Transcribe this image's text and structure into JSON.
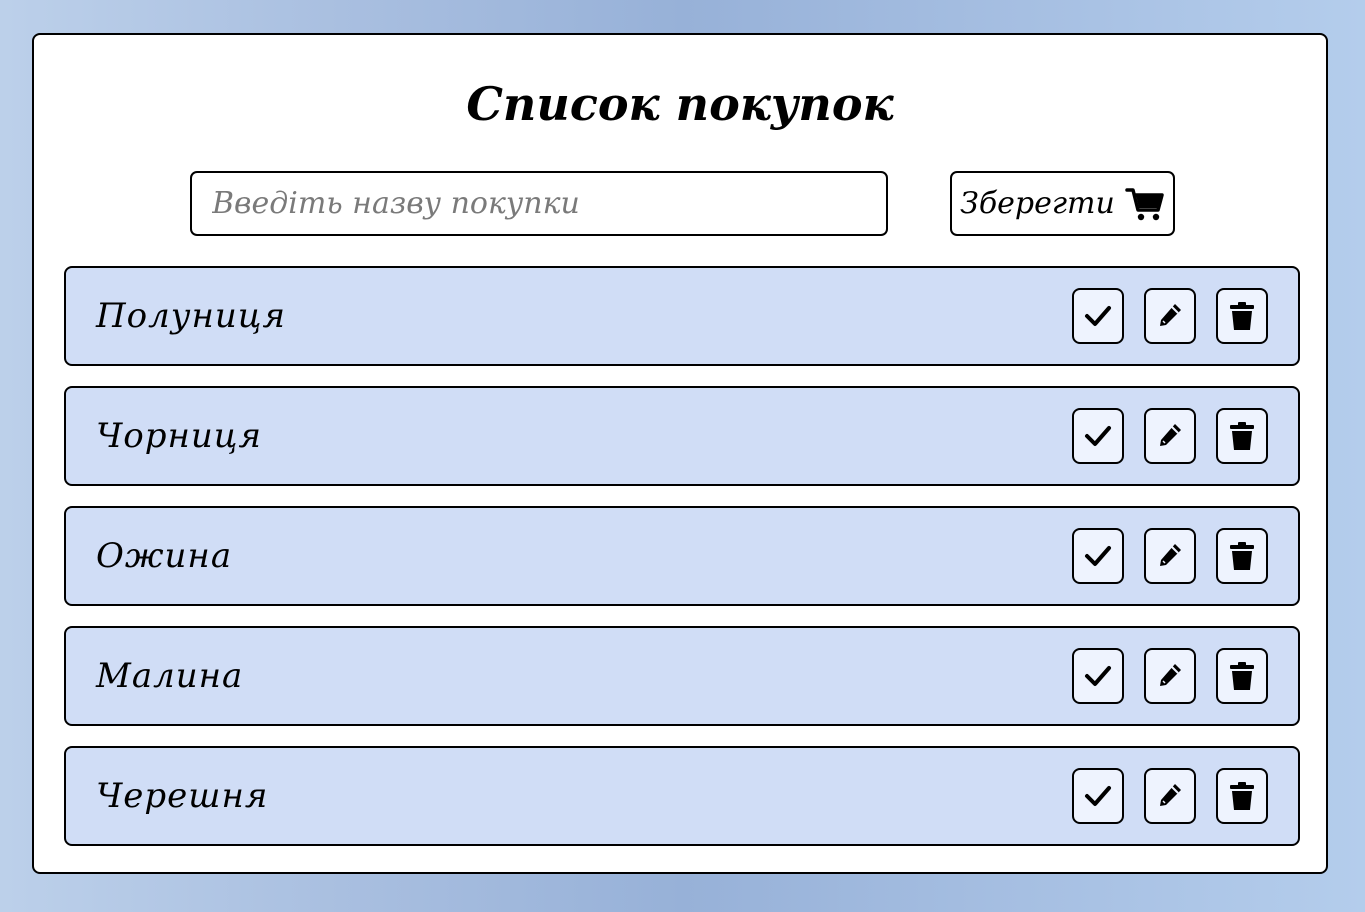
{
  "title": "Список покупок",
  "input": {
    "placeholder": "Введіть назву покупки",
    "value": ""
  },
  "save_button": {
    "label": "Зберегти",
    "icon": "cart-icon"
  },
  "items": [
    {
      "name": "Полуниця"
    },
    {
      "name": "Чорниця"
    },
    {
      "name": "Ожина"
    },
    {
      "name": "Малина"
    },
    {
      "name": "Черешня"
    }
  ],
  "item_actions": {
    "done_icon": "check-icon",
    "edit_icon": "pencil-icon",
    "delete_icon": "trash-icon"
  },
  "colors": {
    "background_gradient": [
      "#bcd0ea",
      "#97b1d8",
      "#b4cdec"
    ],
    "card": "#ffffff",
    "item_bg": "#d0ddf6",
    "action_button_bg": "#eef3fe",
    "border": "#000000"
  }
}
